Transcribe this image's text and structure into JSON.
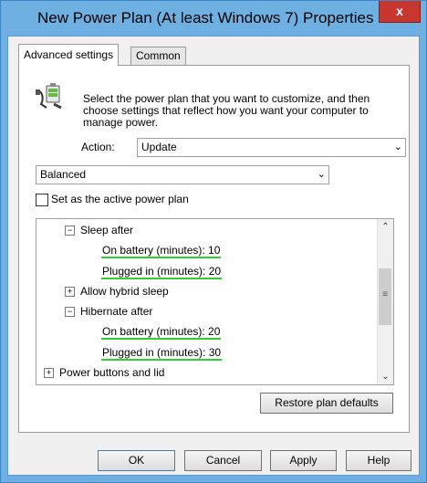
{
  "window": {
    "title": "New Power Plan (At least Windows 7) Properties",
    "close_glyph": "x"
  },
  "tabs": [
    {
      "label": "Advanced settings"
    },
    {
      "label": "Common"
    }
  ],
  "panel": {
    "description": "Select the power plan that you want to customize, and then choose settings that reflect how you want your computer to manage power.",
    "action_label": "Action:",
    "action_value": "Update",
    "plan_value": "Balanced",
    "active_plan_checkbox": {
      "label": "Set as the active power plan",
      "checked": false
    }
  },
  "tree": {
    "sleep_after": {
      "label": "Sleep after",
      "toggle": "−"
    },
    "sleep_on_battery": "On battery (minutes): 10",
    "sleep_plugged_in": "Plugged in (minutes): 20",
    "hybrid_sleep": {
      "label": "Allow hybrid sleep",
      "toggle": "+"
    },
    "hibernate_after": {
      "label": "Hibernate after",
      "toggle": "−"
    },
    "hibernate_on_battery": "On battery (minutes): 20",
    "hibernate_plugged_in": "Plugged in (minutes): 30",
    "power_buttons": {
      "label": "Power buttons and lid",
      "toggle": "+"
    }
  },
  "buttons": {
    "restore": "Restore plan defaults",
    "ok": "OK",
    "cancel": "Cancel",
    "apply": "Apply",
    "help": "Help"
  },
  "colors": {
    "title_bar": "#6fb0e3",
    "close_button": "#c8372f",
    "setting_underline": "#33cc33"
  },
  "icons": {
    "plan": "power-plug-battery-icon",
    "dropdown": "chevron-down-icon"
  }
}
